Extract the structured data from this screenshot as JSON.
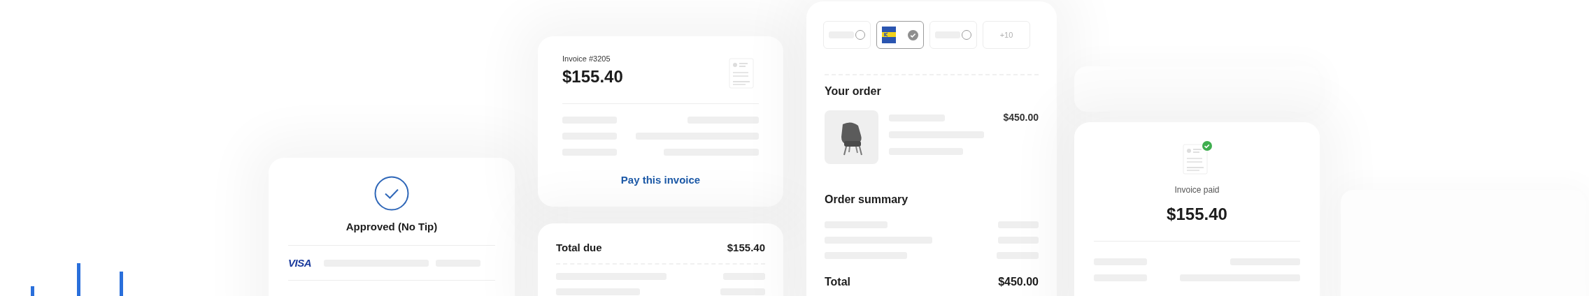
{
  "approval_card": {
    "status": "Approved (No Tip)",
    "card_brand": "VISA"
  },
  "invoice_card": {
    "invoice_number": "Invoice #3205",
    "amount": "$155.40",
    "action": "Pay this invoice"
  },
  "total_due_card": {
    "label": "Total due",
    "amount": "$155.40"
  },
  "checkout_card": {
    "payment_options": [
      {
        "kind": "placeholder",
        "selected": false
      },
      {
        "kind": "logo",
        "selected": true
      },
      {
        "kind": "placeholder",
        "selected": false
      },
      {
        "kind": "more",
        "label": "+10",
        "selected": false
      }
    ],
    "order_title": "Your order",
    "item_price": "$450.00",
    "summary_title": "Order summary",
    "total_label": "Total",
    "total_amount": "$450.00"
  },
  "paid_card": {
    "status": "Invoice paid",
    "amount": "$155.40"
  }
}
